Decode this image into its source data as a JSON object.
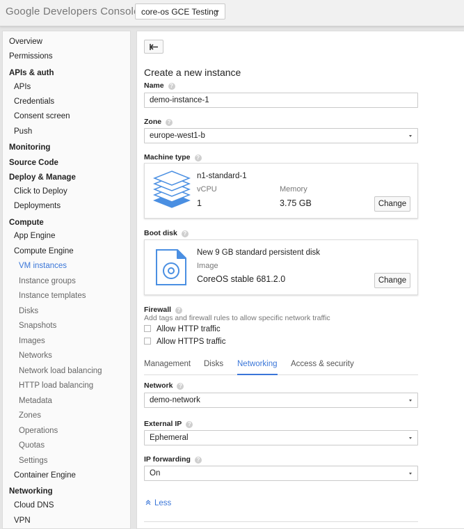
{
  "header": {
    "logo_google": "Google",
    "logo_product": "Developers Console",
    "project": "core-os GCE Testing"
  },
  "sidebar": {
    "items": [
      {
        "label": "Overview"
      },
      {
        "label": "Permissions"
      },
      {
        "label": "APIs & auth"
      },
      {
        "label": "APIs"
      },
      {
        "label": "Credentials"
      },
      {
        "label": "Consent screen"
      },
      {
        "label": "Push"
      },
      {
        "label": "Monitoring"
      },
      {
        "label": "Source Code"
      },
      {
        "label": "Deploy & Manage"
      },
      {
        "label": "Click to Deploy"
      },
      {
        "label": "Deployments"
      },
      {
        "label": "Compute"
      },
      {
        "label": "App Engine"
      },
      {
        "label": "Compute Engine"
      },
      {
        "label": "VM instances"
      },
      {
        "label": "Instance groups"
      },
      {
        "label": "Instance templates"
      },
      {
        "label": "Disks"
      },
      {
        "label": "Snapshots"
      },
      {
        "label": "Images"
      },
      {
        "label": "Networks"
      },
      {
        "label": "Network load balancing"
      },
      {
        "label": "HTTP load balancing"
      },
      {
        "label": "Metadata"
      },
      {
        "label": "Zones"
      },
      {
        "label": "Operations"
      },
      {
        "label": "Quotas"
      },
      {
        "label": "Settings"
      },
      {
        "label": "Container Engine"
      },
      {
        "label": "Networking"
      },
      {
        "label": "Cloud DNS"
      },
      {
        "label": "VPN"
      }
    ]
  },
  "main": {
    "title": "Create a new instance",
    "help_glyph": "?",
    "name": {
      "label": "Name",
      "value": "demo-instance-1"
    },
    "zone": {
      "label": "Zone",
      "value": "europe-west1-b"
    },
    "machine_type": {
      "label": "Machine type",
      "name": "n1-standard-1",
      "vcpu_label": "vCPU",
      "vcpu_value": "1",
      "memory_label": "Memory",
      "memory_value": "3.75 GB",
      "change_label": "Change"
    },
    "boot_disk": {
      "label": "Boot disk",
      "name": "New 9 GB standard persistent disk",
      "image_label": "Image",
      "image_value": "CoreOS stable 681.2.0",
      "change_label": "Change"
    },
    "firewall": {
      "label": "Firewall",
      "hint": "Add tags and firewall rules to allow specific network traffic",
      "allow_http": "Allow HTTP traffic",
      "allow_https": "Allow HTTPS traffic"
    },
    "tabs": [
      {
        "label": "Management"
      },
      {
        "label": "Disks"
      },
      {
        "label": "Networking"
      },
      {
        "label": "Access & security"
      }
    ],
    "network": {
      "label": "Network",
      "value": "demo-network"
    },
    "external_ip": {
      "label": "External IP",
      "value": "Ephemeral"
    },
    "ip_forwarding": {
      "label": "IP forwarding",
      "value": "On"
    },
    "less_label": "Less"
  },
  "colors": {
    "accent": "#3a76d8",
    "icon_blue": "#4a8fe2"
  }
}
